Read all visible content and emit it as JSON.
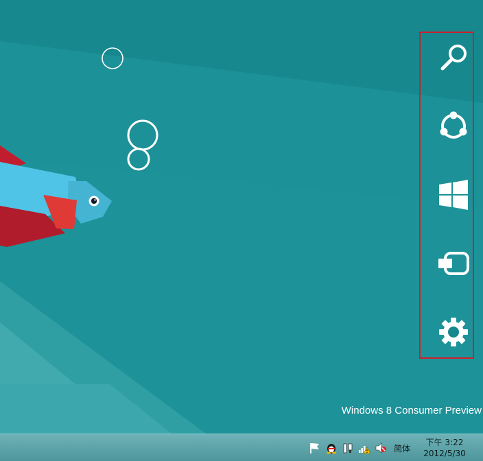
{
  "desktop": {
    "watermark": "Windows 8 Consumer Preview"
  },
  "charms": [
    {
      "name": "search",
      "icon": "search-icon"
    },
    {
      "name": "share",
      "icon": "share-icon"
    },
    {
      "name": "start",
      "icon": "windows-logo-icon"
    },
    {
      "name": "devices",
      "icon": "devices-icon"
    },
    {
      "name": "settings",
      "icon": "gear-icon"
    }
  ],
  "taskbar": {
    "tray_icons": [
      "action-center-flag-icon",
      "qq-icon",
      "network-adapter-icon",
      "signal-warning-icon",
      "volume-muted-icon"
    ],
    "ime_label": "简体",
    "clock": {
      "time": "下午 3:22",
      "date": "2012/5/30"
    }
  },
  "colors": {
    "wallpaper": "#1a8a8f",
    "charm_highlight_border": "#d11f2a",
    "fish_blue": "#4fc4e6",
    "fish_red": "#c01e2e"
  }
}
